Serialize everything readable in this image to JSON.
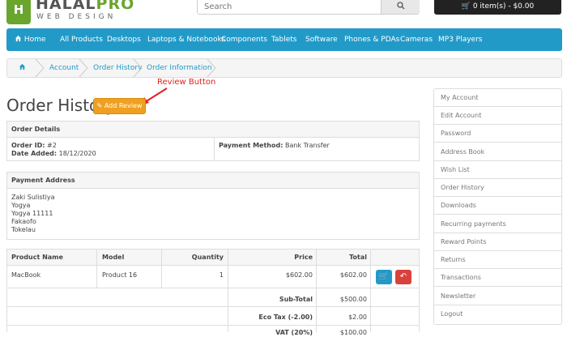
{
  "brand": {
    "logo_mark": "H",
    "name_a": "HALAL",
    "name_b": "PRO",
    "subtitle": "WEB DESIGN"
  },
  "search": {
    "placeholder": "Search",
    "icon": "search-icon"
  },
  "cart": {
    "label": "🛒 0 item(s) - $0.00"
  },
  "nav": {
    "home": "Home",
    "items": [
      "All Products",
      "Desktops",
      "Laptops & Notebooks",
      "Components",
      "Tablets",
      "Software",
      "Phones & PDAs",
      "Cameras",
      "MP3 Players"
    ]
  },
  "breadcrumb": {
    "items": [
      "Account",
      "Order History",
      "Order Information"
    ]
  },
  "annotation": {
    "label": "Review Button",
    "color": "#e02020"
  },
  "page": {
    "title": "Order History",
    "add_review": "Add Review"
  },
  "order_details": {
    "header": "Order Details",
    "order_id_label": "Order ID:",
    "order_id": "#2",
    "date_label": "Date Added:",
    "date": "18/12/2020",
    "payment_label": "Payment Method:",
    "payment": "Bank Transfer"
  },
  "payment_address": {
    "header": "Payment Address",
    "lines": [
      "Zaki Sulistiya",
      "Yogya",
      "Yogya 11111",
      "Fakaofo",
      "Tokelau"
    ]
  },
  "products": {
    "headers": [
      "Product Name",
      "Model",
      "Quantity",
      "Price",
      "Total"
    ],
    "rows": [
      {
        "name": "MacBook",
        "model": "Product 16",
        "qty": "1",
        "price": "$602.00",
        "total": "$602.00"
      }
    ],
    "totals": [
      {
        "label": "Sub-Total",
        "value": "$500.00"
      },
      {
        "label": "Eco Tax (-2.00)",
        "value": "$2.00"
      },
      {
        "label": "VAT (20%)",
        "value": "$100.00"
      }
    ]
  },
  "sidebar": {
    "items": [
      "My Account",
      "Edit Account",
      "Password",
      "Address Book",
      "Wish List",
      "Order History",
      "Downloads",
      "Recurring payments",
      "Reward Points",
      "Returns",
      "Transactions",
      "Newsletter",
      "Logout"
    ]
  },
  "colors": {
    "accent": "#229ac8",
    "review": "#f0a020",
    "return": "#d9423b"
  }
}
